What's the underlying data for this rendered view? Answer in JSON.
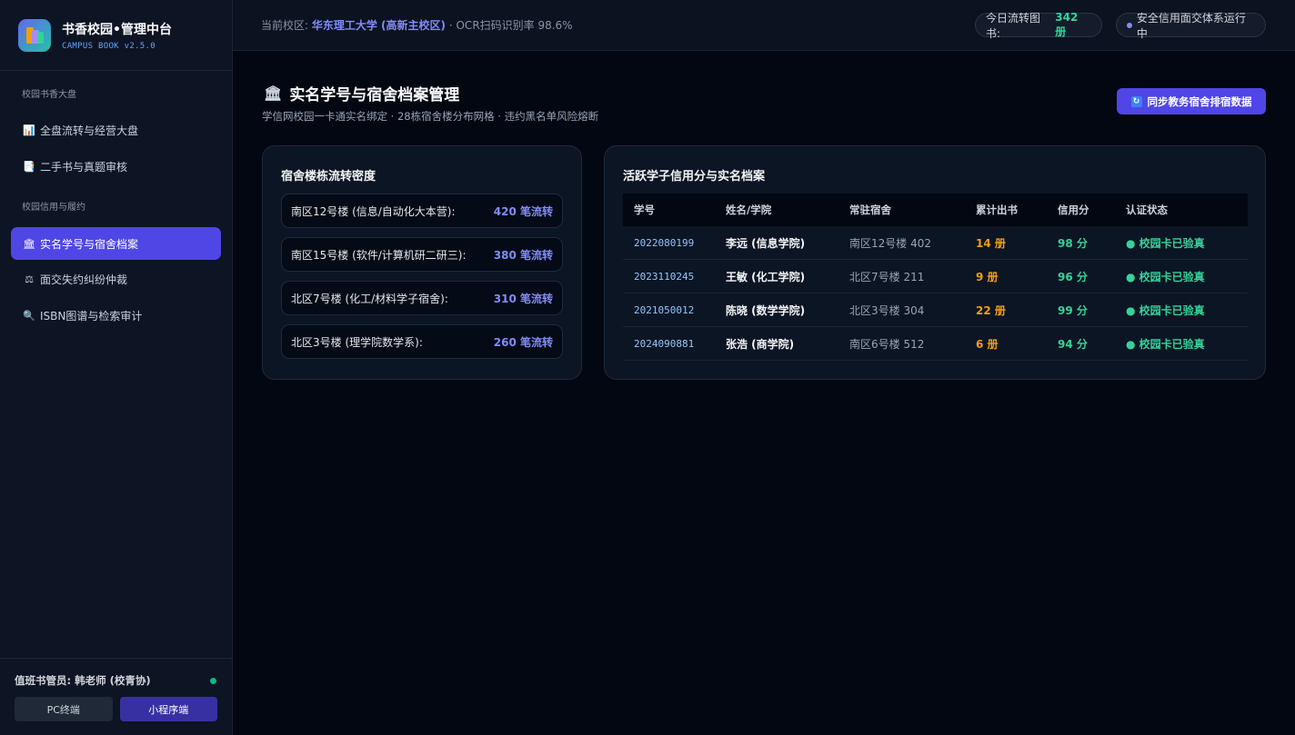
{
  "brand": {
    "title": "书香校园•管理中台",
    "subtitle": "CAMPUS BOOK v2.5.0"
  },
  "sidebar": {
    "sections": [
      {
        "label": "校园书香大盘"
      },
      {
        "label": "校园信用与履约"
      }
    ],
    "items": [
      {
        "label": "全盘流转与经营大盘",
        "icon": "bar-chart-icon"
      },
      {
        "label": "二手书与真题审核",
        "icon": "document-icon"
      },
      {
        "label": "实名学号与宿舍档案",
        "icon": "building-icon",
        "active": true
      },
      {
        "label": "面交失约纠纷仲裁",
        "icon": "scales-icon"
      },
      {
        "label": "ISBN图谱与检索审计",
        "icon": "magnifier-icon"
      }
    ],
    "footer": {
      "duty": "值班书管员: 韩老师 (校青协)",
      "pc_label": "PC终端",
      "mini_label": "小程序端"
    }
  },
  "topbar": {
    "campus_label": "当前校区:",
    "campus_name": "华东理工大学 (高新主校区)",
    "ocr_text": "· OCR扫码识别率 98.6%",
    "flow_label": "今日流转图书:",
    "flow_value": "342 册",
    "safe_label": "安全信用面交体系运行中"
  },
  "page": {
    "title": "实名学号与宿舍档案管理",
    "subtitle": "学信网校园一卡通实名绑定 · 28栋宿舍楼分布网格 · 违约黑名单风险熔断",
    "sync_button": "同步教务宿舍排宿数据"
  },
  "dorm_card": {
    "title": "宿舍楼栋流转密度",
    "rows": [
      {
        "name": "南区12号楼 (信息/自动化大本营):",
        "value": "420 笔流转"
      },
      {
        "name": "南区15号楼 (软件/计算机研二研三):",
        "value": "380 笔流转"
      },
      {
        "name": "北区7号楼 (化工/材料学子宿舍):",
        "value": "310 笔流转"
      },
      {
        "name": "北区3号楼 (理学院数学系):",
        "value": "260 笔流转"
      }
    ]
  },
  "student_card": {
    "title": "活跃学子信用分与实名档案",
    "headers": [
      "学号",
      "姓名/学院",
      "常驻宿舍",
      "累计出书",
      "信用分",
      "认证状态"
    ],
    "rows": [
      {
        "id": "2022080199",
        "name": "李远 (信息学院)",
        "dorm": "南区12号楼 402",
        "books": "14 册",
        "credit": "98 分",
        "status": "● 校园卡已验真"
      },
      {
        "id": "2023110245",
        "name": "王敏 (化工学院)",
        "dorm": "北区7号楼 211",
        "books": "9 册",
        "credit": "96 分",
        "status": "● 校园卡已验真"
      },
      {
        "id": "2021050012",
        "name": "陈晓 (数学学院)",
        "dorm": "北区3号楼 304",
        "books": "22 册",
        "credit": "99 分",
        "status": "● 校园卡已验真"
      },
      {
        "id": "2024090881",
        "name": "张浩 (商学院)",
        "dorm": "南区6号楼 512",
        "books": "6 册",
        "credit": "94 分",
        "status": "● 校园卡已验真"
      }
    ]
  },
  "colors": {
    "accent": "#4f46e5",
    "success": "#34d399",
    "warning": "#f59e0b",
    "link": "#818cf8"
  }
}
